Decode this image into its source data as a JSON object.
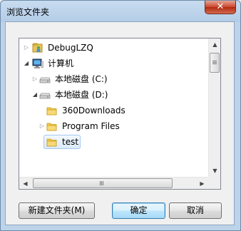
{
  "window": {
    "title": "浏览文件夹",
    "close_symbol": "✕"
  },
  "tree": {
    "items": [
      {
        "label": "DebugLZQ",
        "icon": "user-folder-icon",
        "state": "collapsed"
      },
      {
        "label": "计算机",
        "icon": "computer-icon",
        "state": "expanded"
      },
      {
        "label": "本地磁盘 (C:)",
        "icon": "drive-icon",
        "state": "collapsed"
      },
      {
        "label": "本地磁盘 (D:)",
        "icon": "drive-icon",
        "state": "expanded"
      },
      {
        "label": "360Downloads",
        "icon": "folder-icon",
        "state": "none"
      },
      {
        "label": "Program Files",
        "icon": "folder-icon",
        "state": "collapsed"
      },
      {
        "label": "test",
        "icon": "folder-icon",
        "state": "none",
        "selected": true
      }
    ]
  },
  "buttons": {
    "new_folder": "新建文件夹(M)",
    "ok": "确定",
    "cancel": "取消"
  },
  "colors": {
    "title_bar": "#bcd3ea",
    "close_button": "#c9452c",
    "selection_border": "#a3c9f1",
    "folder_yellow": "#f2c94c"
  }
}
